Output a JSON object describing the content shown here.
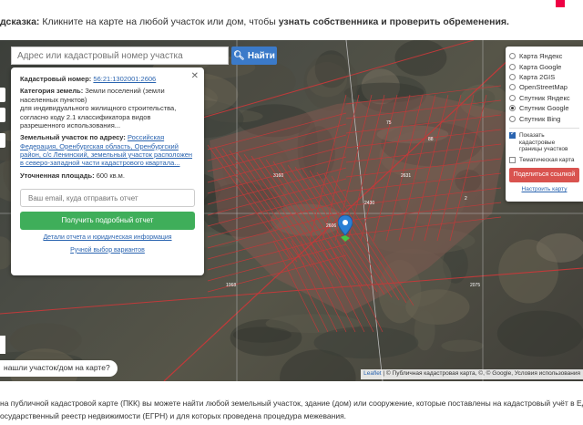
{
  "page": {
    "hint_prefix": "дсказка:",
    "hint_text": " Кликните на карте на любой участок или дом, чтобы ",
    "hint_bold": "узнать собственника и проверить обременения."
  },
  "search": {
    "placeholder": "Адрес или кадастровый номер участка",
    "button_label": "Найти"
  },
  "popup": {
    "cad_label": "Кадастровый номер:",
    "cad_value": "56:21:1302001:2606",
    "cat_label": "Категория земель:",
    "cat_value": "Земли поселений (земли населенных пунктов)",
    "use_text": "для индивидуального жилищного строительства, согласно коду 2.1 классификатора видов разрешенного использования...",
    "addr_label": "Земельный участок по адресу:",
    "addr_value": "Российская Федерация, Оренбургская область, Оренбургский район, с/с Ленинский, земельный участок расположен в северо-западной части кадастрового квартала...",
    "area_label": "Уточненная площадь:",
    "area_value": "600 кв.м.",
    "email_placeholder": "Ваш email, куда отправить отчет",
    "report_button": "Получить подробный отчет",
    "details_link": "Детали отчета и юридическая информация",
    "manual_link": "Ручной выбор вариантов"
  },
  "layers": {
    "items": [
      {
        "label": "Карта Яндекс",
        "selected": false
      },
      {
        "label": "Карта Google",
        "selected": false
      },
      {
        "label": "Карта 2GIS",
        "selected": false
      },
      {
        "label": "OpenStreetMap",
        "selected": false
      },
      {
        "label": "Спутник Яндекс",
        "selected": false
      },
      {
        "label": "Спутник Google",
        "selected": true
      },
      {
        "label": "Спутник Bing",
        "selected": false
      }
    ],
    "show_borders": "Показать кадастровые границы участков",
    "thematic_map": "Тематическая карта",
    "share_button": "Поделиться ссылкой",
    "setup_link": "Настроить карту"
  },
  "map": {
    "not_found": "нашли участок/дом на карте?",
    "attribution_leaflet": "Leaflet",
    "attribution_text": " | © Публичная кадастровая карта, ©, © Google, Условия использования",
    "labels": [
      "2606",
      "2075",
      "1068",
      "75",
      "88",
      "2",
      "2631",
      "2430",
      "3160"
    ]
  },
  "bottom": {
    "line1": "на публичной кадастровой карте (ПКК) вы можете найти любой земельный участок, здание (дом) или сооружение, которые поставлены на кадастровый учёт в Еди",
    "line2": "осударственный реестр недвижимости (ЕГРН) и для которых проведена процедура межевания."
  },
  "colors": {
    "search_button": "#3b7ac9",
    "report_button": "#3fae5a",
    "share_button": "#d9534f",
    "parcel_lines": "#b03030",
    "link": "#2a64b0"
  }
}
